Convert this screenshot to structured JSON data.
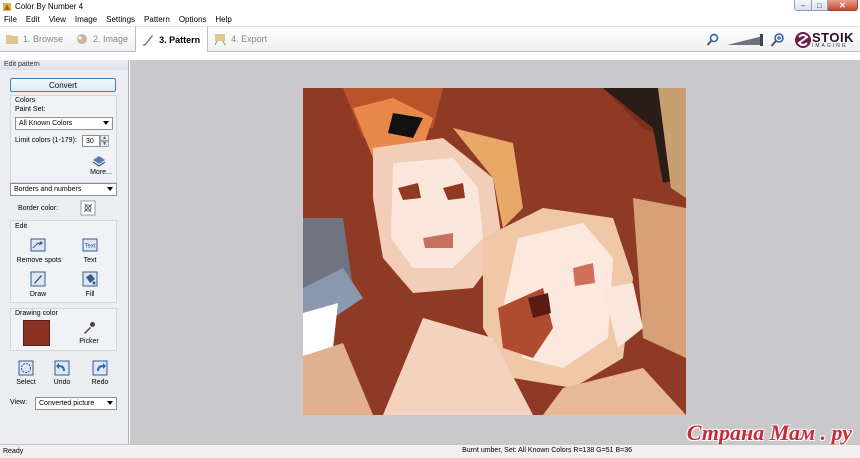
{
  "window": {
    "title": "Color By Number 4"
  },
  "menu": [
    "File",
    "Edit",
    "View",
    "Image",
    "Settings",
    "Pattern",
    "Options",
    "Help"
  ],
  "tabs": [
    {
      "label": "1. Browse",
      "active": false,
      "icon": "folder-icon"
    },
    {
      "label": "2. Image",
      "active": false,
      "icon": "image-icon"
    },
    {
      "label": "3. Pattern",
      "active": true,
      "icon": "brush-icon"
    },
    {
      "label": "4. Export",
      "active": false,
      "icon": "easel-icon"
    }
  ],
  "brand": {
    "name": "STOIK",
    "sub": "IMAGING"
  },
  "panel": {
    "header": "Edit pattern",
    "convert": "Convert",
    "colors_title": "Colors",
    "paint_set_label": "Paint Set:",
    "paint_set_value": "All Known Colors",
    "limit_label": "Limit colors (1-179):",
    "limit_value": "30",
    "more": "More...",
    "borders_value": "Borders and numbers",
    "border_color_label": "Border color:",
    "edit_title": "Edit",
    "tools": {
      "remove_spots": "Remove spots",
      "text": "Text",
      "draw": "Draw",
      "fill": "Fill"
    },
    "drawing_color_title": "Drawing color",
    "drawing_color": "#8a3324",
    "picker": "Picker",
    "actions": {
      "select": "Select",
      "undo": "Undo",
      "redo": "Redo"
    },
    "view_label": "View:",
    "view_value": "Converted picture"
  },
  "status": {
    "ready": "Ready",
    "info": "Burnt umber, Set: All Known Colors R=138 G=51 B=36"
  },
  "watermark": "Страна Мам . ру"
}
